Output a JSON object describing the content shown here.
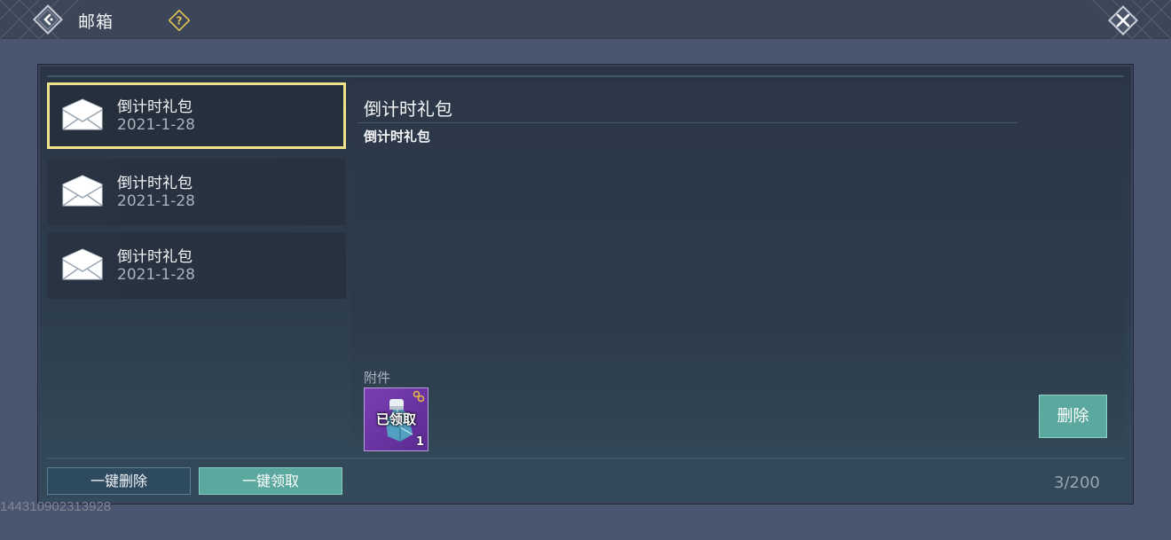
{
  "header": {
    "title": "邮箱",
    "back_icon": "back-arrow-icon",
    "help_icon": "question-icon",
    "close_icon": "close-icon"
  },
  "mail_list": [
    {
      "title": "倒计时礼包",
      "date": "2021-1-28",
      "selected": true
    },
    {
      "title": "倒计时礼包",
      "date": "2021-1-28",
      "selected": false
    },
    {
      "title": "倒计时礼包",
      "date": "2021-1-28",
      "selected": false
    }
  ],
  "detail": {
    "title": "倒计时礼包",
    "body": "倒计时礼包",
    "attachment_label": "附件",
    "attachment": {
      "status": "已领取",
      "quantity": "1",
      "icon": "gem-icon"
    },
    "delete_label": "删除"
  },
  "footer": {
    "delete_all_label": "一键删除",
    "claim_all_label": "一键领取",
    "count": "3/200"
  },
  "user_id": "144310902313928",
  "colors": {
    "accent_teal": "#5aa89e",
    "selected_border": "#f0e28a",
    "attachment_purple": "#6b35a3",
    "background": "#4a5570"
  }
}
